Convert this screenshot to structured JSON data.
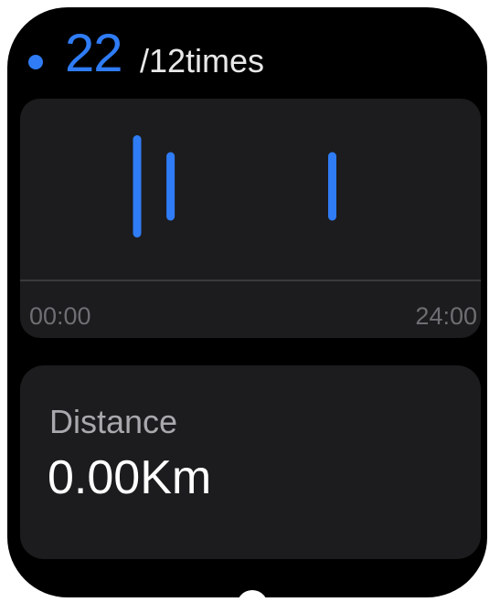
{
  "colors": {
    "accent": "#2f7cf6",
    "background": "#000000",
    "card": "#1c1c1e",
    "muted_text": "#6e6e73"
  },
  "header": {
    "indicator_icon": "blue-dot-icon",
    "count": "22",
    "goal": "/12times"
  },
  "chart_data": {
    "type": "bar",
    "title": "",
    "xlabel": "",
    "ylabel": "",
    "x_axis_labels": [
      "00:00",
      "24:00"
    ],
    "xlim_hours": [
      0,
      24
    ],
    "grid": false,
    "legend": "none",
    "series": [
      {
        "x_hours": [
          5.9,
          7.7,
          16.4
        ],
        "values": [
          1.0,
          0.67,
          0.67
        ]
      }
    ]
  },
  "distance": {
    "label": "Distance",
    "value": "0.00Km"
  },
  "pager": {
    "icon": "page-indicator-icon"
  }
}
